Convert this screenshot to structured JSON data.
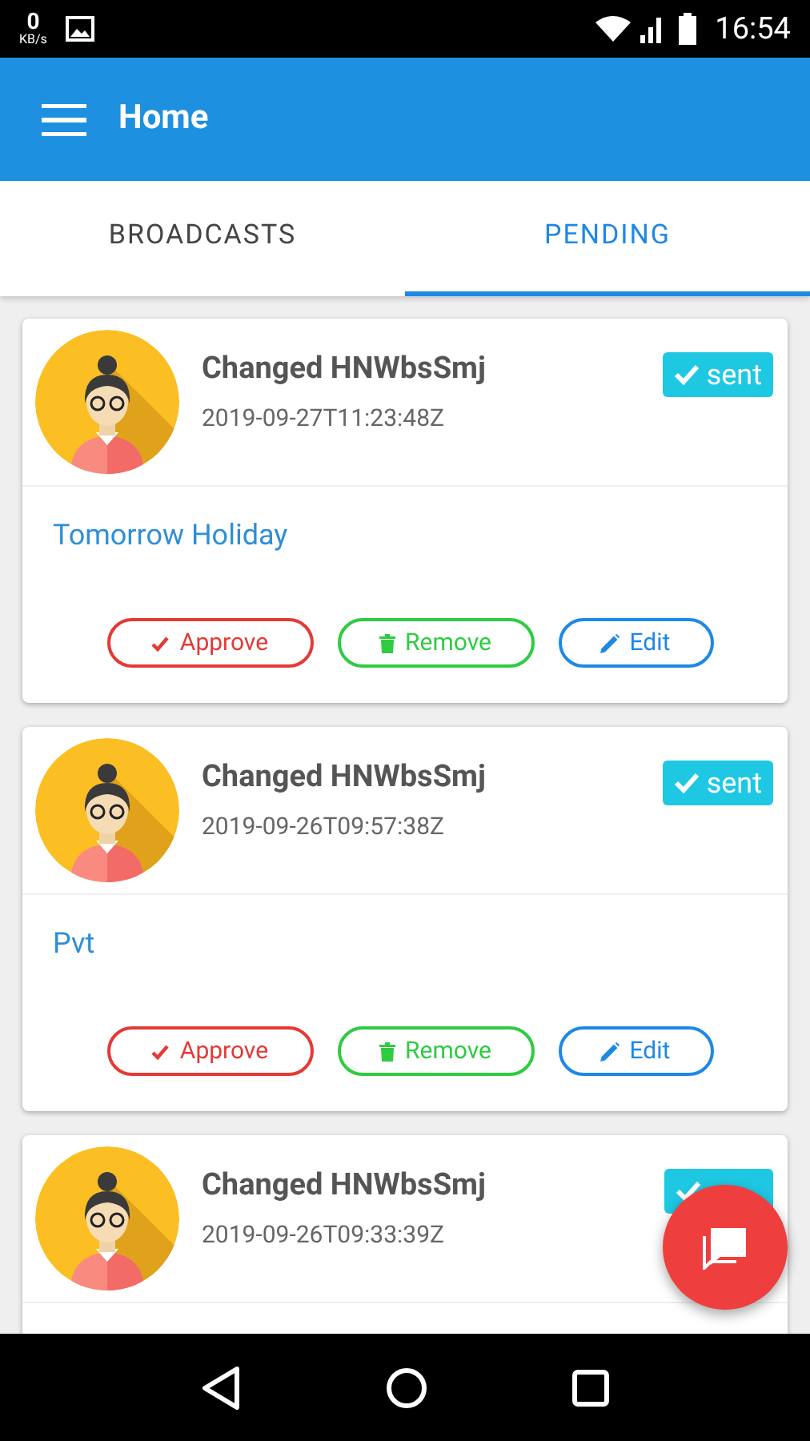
{
  "status_bar": {
    "speed": "0",
    "speed_unit": "KB/s",
    "time": "16:54"
  },
  "app_bar": {
    "title": "Home"
  },
  "tabs": [
    {
      "label": "BROADCASTS",
      "selected": false
    },
    {
      "label": "PENDING",
      "selected": true
    }
  ],
  "cards": [
    {
      "author": "Changed HNWbsSmj",
      "timestamp": "2019-09-27T11:23:48Z",
      "status": "sent",
      "message": "Tomorrow Holiday",
      "actions": [
        {
          "kind": "approve",
          "label": "Approve"
        },
        {
          "kind": "remove",
          "label": "Remove"
        },
        {
          "kind": "edit",
          "label": "Edit"
        }
      ]
    },
    {
      "author": "Changed HNWbsSmj",
      "timestamp": "2019-09-26T09:57:38Z",
      "status": "sent",
      "message": "Pvt",
      "actions": [
        {
          "kind": "approve",
          "label": "Approve"
        },
        {
          "kind": "remove",
          "label": "Remove"
        },
        {
          "kind": "edit",
          "label": "Edit"
        }
      ]
    },
    {
      "author": "Changed HNWbsSmj",
      "timestamp": "2019-09-26T09:33:39Z",
      "status_covered": true
    }
  ]
}
